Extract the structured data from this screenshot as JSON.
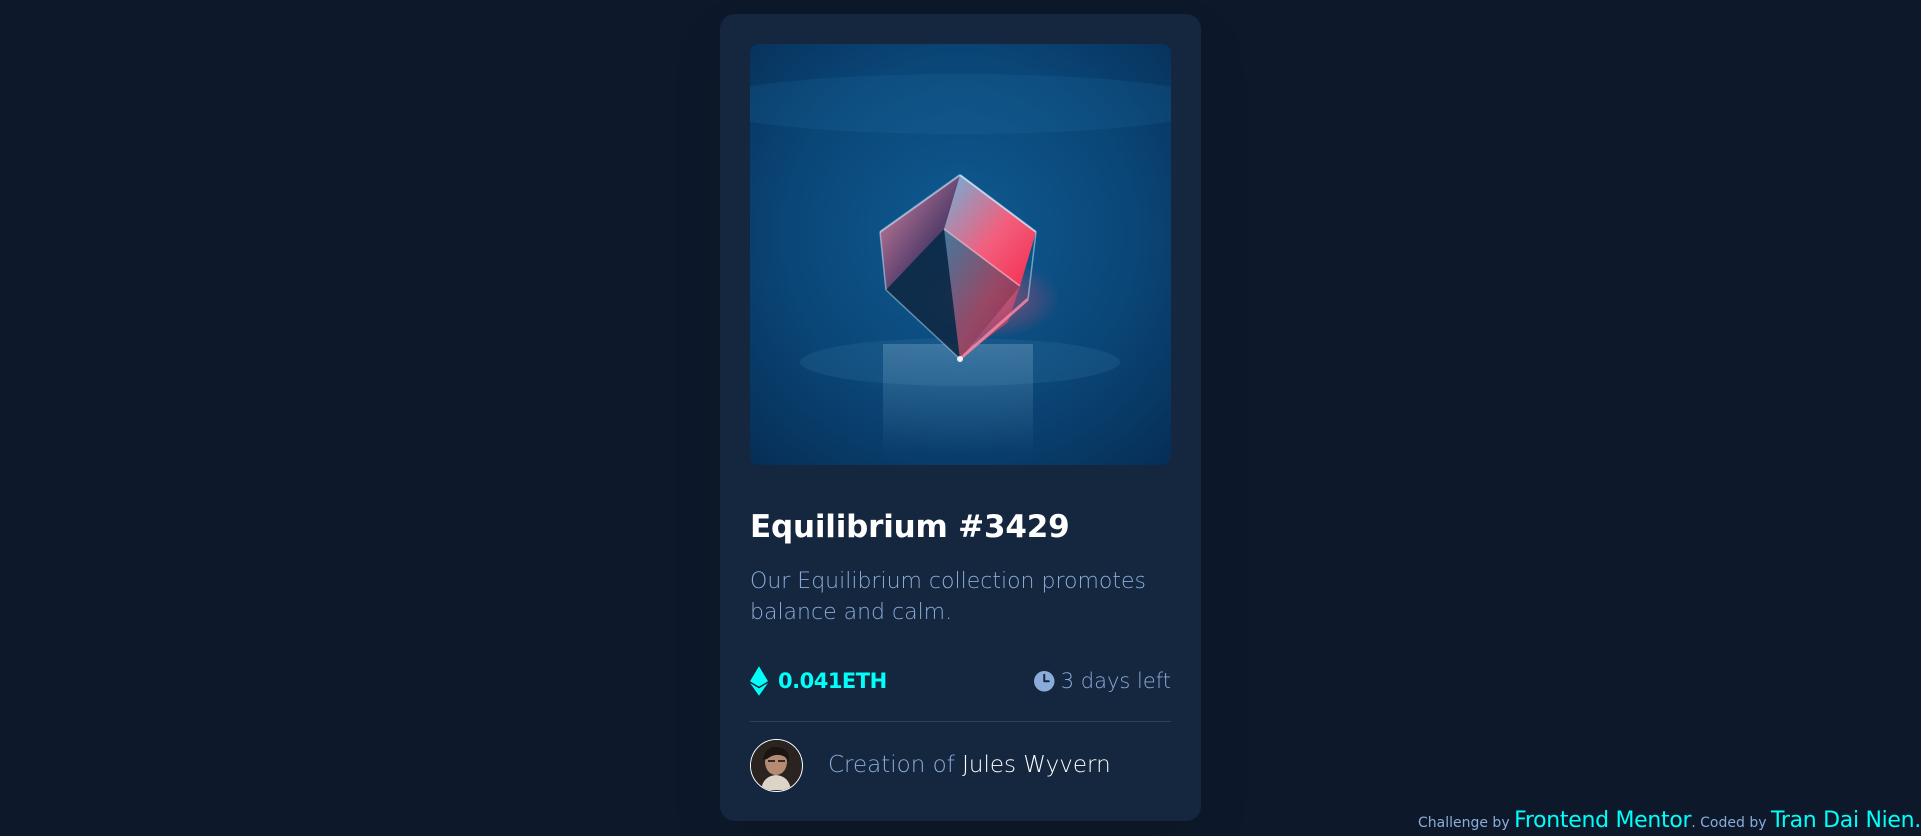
{
  "card": {
    "image_alt": "equilibrium-image",
    "title": "Equilibrium #3429",
    "description": "Our Equilibrium collection promotes balance and calm.",
    "price": "0.041ETH",
    "time_left": "3 days left",
    "creator_prefix": "Creation of",
    "creator_name": "Jules Wyvern"
  },
  "attribution": {
    "challenge_prefix": "Challenge by",
    "challenge_link": "Frontend Mentor",
    "separator": ". Coded by",
    "author_link": "Tran Dai Nien",
    "end": "."
  },
  "colors": {
    "page_bg": "#0d192b",
    "card_bg": "#15263f",
    "cyan": "#00fff8",
    "soft_blue": "#8bacd9",
    "white": "#ffffff",
    "divider": "#2e405a"
  },
  "icons": {
    "price": "ethereum-icon",
    "time": "clock-icon"
  }
}
